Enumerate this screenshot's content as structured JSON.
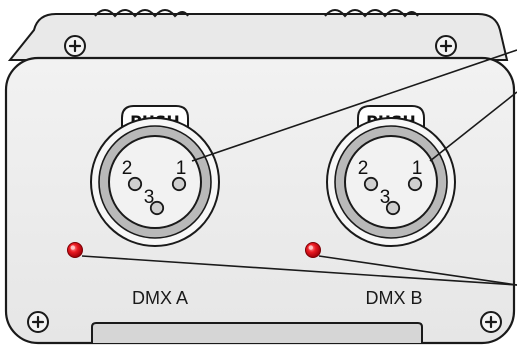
{
  "connectors": [
    {
      "push_label": "PUSH",
      "pins": [
        "2",
        "1",
        "3"
      ],
      "port_label": "DMX A",
      "indicator_color": "#e8141c"
    },
    {
      "push_label": "PUSH",
      "pins": [
        "2",
        "1",
        "3"
      ],
      "port_label": "DMX B",
      "indicator_color": "#e8141c"
    }
  ],
  "colors": {
    "housing_fill": "#ececec",
    "housing_stroke": "#1a1a1a",
    "connector_ring": "#b9b9b9",
    "led_red": "#e8141c"
  },
  "icons": [
    "screw-icon",
    "screw-icon",
    "screw-icon",
    "screw-icon"
  ]
}
